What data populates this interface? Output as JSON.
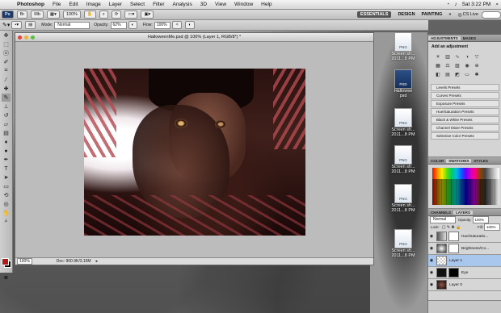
{
  "menubar": {
    "apple": "",
    "items": [
      "Photoshop",
      "File",
      "Edit",
      "Image",
      "Layer",
      "Select",
      "Filter",
      "Analysis",
      "3D",
      "View",
      "Window",
      "Help"
    ],
    "clock": "Sat 3:22 PM"
  },
  "appbar": {
    "zoom": "100%",
    "workspaces": [
      "ESSENTIALS",
      "DESIGN",
      "PAINTING"
    ],
    "cs_live": "CS Live"
  },
  "options": {
    "mode_label": "Mode:",
    "mode_value": "Normal",
    "opacity_label": "Opacity:",
    "opacity_value": "62%",
    "flow_label": "Flow:",
    "flow_value": "100%"
  },
  "document": {
    "title": "HalloweenMe.psd @ 100% (Layer 1, RGB/8*) *",
    "status_zoom": "100%",
    "status_doc": "Doc: 900.9K/3.15M"
  },
  "desktop_files": [
    {
      "label": "Screen sh...\n2011...8 PM",
      "badge": "PNG"
    },
    {
      "label": "Hallowee\npsd",
      "badge": "PSD"
    },
    {
      "label": "Screen sh...\n2011...8 PM",
      "badge": "PNG"
    },
    {
      "label": "Screen sh...\n2011...8 PM",
      "badge": "PNG"
    },
    {
      "label": "Screen sh...\n2011...8 PM",
      "badge": "PNG"
    },
    {
      "label": "Screen sh...\n2011...8 PM",
      "badge": "PNG"
    }
  ],
  "adjustments": {
    "tabs": [
      "ADJUSTMENTS",
      "MASKS"
    ],
    "add_label": "Add an adjustment",
    "presets": [
      "Levels Presets",
      "Curves Presets",
      "Exposure Presets",
      "Hue/Saturation Presets",
      "Black & White Presets",
      "Channel Mixer Presets",
      "Selective Color Presets"
    ]
  },
  "swatches": {
    "tabs": [
      "COLOR",
      "SWATCHES",
      "STYLES"
    ]
  },
  "layers": {
    "tabs": [
      "CHANNELS",
      "LAYERS"
    ],
    "blend": "Normal",
    "opacity_label": "Opacity:",
    "opacity": "100%",
    "fill_label": "Fill:",
    "fill": "100%",
    "lock_label": "Lock:",
    "rows": [
      {
        "name": "Hue/Saturatio...",
        "selected": false
      },
      {
        "name": "Brightness/Co...",
        "selected": false
      },
      {
        "name": "Layer 1",
        "selected": true
      },
      {
        "name": "Eye",
        "selected": false
      },
      {
        "name": "Layer 0",
        "selected": false
      }
    ]
  },
  "colors": {
    "fg": "#b01a17",
    "bg": "#000000",
    "layer_selected": "#a9c6ec"
  }
}
